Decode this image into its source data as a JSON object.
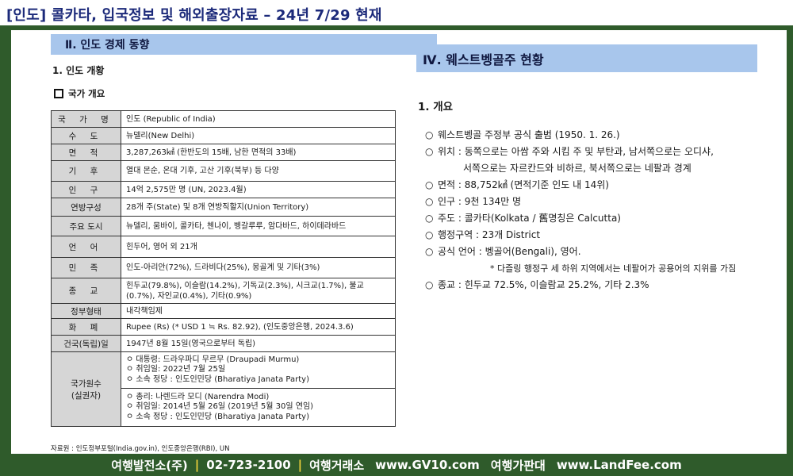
{
  "header": {
    "title": "[인도] 콜카타,  입국정보 및 해외출장자료 – 24년 7/29 현재"
  },
  "left": {
    "section_title": "Ⅱ. 인도 경제 동향",
    "subtitle": "1. 인도 개황",
    "box_title": "국가 개요",
    "rows": [
      {
        "key": "국 가 명",
        "value": "인도 (Republic of India)"
      },
      {
        "key": "수 도",
        "value": "뉴델리(New Delhi)"
      },
      {
        "key": "면 적",
        "value": "3,287,263㎢ (한반도의 15배, 남한 면적의 33배)"
      },
      {
        "key": "기 후",
        "value": "열대 몬순, 온대 기후, 고산 기후(북부) 등 다양"
      },
      {
        "key": "인 구",
        "value": "14억 2,575만 명 (UN, 2023.4월)"
      },
      {
        "key": "연방구성",
        "value": "28개 주(State) 및 8개 연방직할지(Union Territory)"
      },
      {
        "key": "주요 도시",
        "value": "뉴델리, 뭄바이, 콜카타, 첸나이, 벵갈루루, 암다바드, 하이데라바드"
      },
      {
        "key": "언 어",
        "value": "힌두어, 영어 외 21개"
      },
      {
        "key": "민 족",
        "value": "인도-아리안(72%), 드라비다(25%), 몽골계 및 기타(3%)"
      },
      {
        "key": "종 교",
        "value": "힌두교(79.8%), 이슬람(14.2%), 기독교(2.3%), 시크교(1.7%), 불교(0.7%), 자인교(0.4%), 기타(0.9%)"
      },
      {
        "key": "정부형태",
        "value": "내각책임제"
      },
      {
        "key": "화 폐",
        "value": "Rupee (Rs) (* USD 1 ≒ Rs. 82.92), (인도중앙은행, 2024.3.6)"
      },
      {
        "key": "건국(독립)일",
        "value": "1947년 8월 15일(영국으로부터 독립)"
      }
    ],
    "leader": {
      "key_line1": "국가원수",
      "key_line2": "(실권자)",
      "president": [
        "ㅇ  대통령: 드라우파디 무르무 (Draupadi Murmu)",
        "ㅇ  취임일: 2022년 7월 25일",
        "ㅇ  소속 정당 : 인도인민당 (Bharatiya Janata Party)"
      ],
      "pm": [
        "ㅇ  총리: 나렌드라 모디 (Narendra Modi)",
        "ㅇ  취임일: 2014년 5월 26일 (2019년 5월 30일 연임)",
        "ㅇ  소속 정당 : 인도인민당 (Bharatiya Janata Party)"
      ]
    },
    "source": "자료원 : 인도정부포털(India.gov.in), 인도중앙은행(RBI), UN"
  },
  "right": {
    "section_title": "Ⅳ. 웨스트벵골주 현황",
    "subtitle": "1. 개요",
    "bullet": "○",
    "items": [
      {
        "text": "웨스트벵골 주정부 공식 출범 (1950. 1. 26.)"
      },
      {
        "text": "위치 : 동쪽으로는 아쌈 주와 시킴 주 및 부탄과, 남서쪽으로는 오디샤,",
        "cont": "서쪽으로는 자르칸드와 비하르, 북서쪽으로는 네팔과 경계"
      },
      {
        "text": "면적 : 88,752㎢ (면적기준 인도 내 14위)"
      },
      {
        "text": "인구 : 9천 134만 명"
      },
      {
        "text": "주도 : 콜카타(Kolkata / 舊명칭은 Calcutta)"
      },
      {
        "text": "행정구역 : 23개 District"
      },
      {
        "text": "공식 언어 : 벵골어(Bengali), 영어.",
        "note": "* 다즐링 행정구 세 하위 지역에서는 네팔어가 공용어의 지위를 가짐"
      },
      {
        "text": "종교 : 힌두교 72.5%, 이슬람교 25.2%, 기타 2.3%"
      }
    ]
  },
  "footer": {
    "company": "여행발전소(주)",
    "phone": "02-723-2100",
    "label1": "여행거래소",
    "site1": "www.GV10.com",
    "label2": "여행가판대",
    "site2": "www.LandFee.com",
    "separator": "|",
    "separator_color": "#f2d23b"
  }
}
